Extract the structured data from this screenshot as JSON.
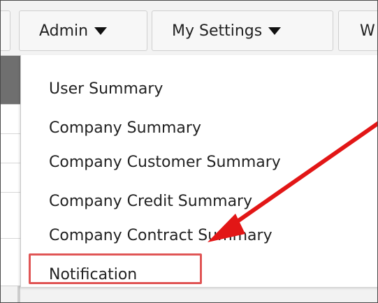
{
  "nav": {
    "admin_label": "Admin",
    "settings_label": "My Settings",
    "partial_label": "W"
  },
  "menu": {
    "items": [
      "User Summary",
      "Company Summary",
      "Company Customer Summary",
      "Company Credit Summary",
      "Company Contract Summary",
      "Notification"
    ]
  },
  "colors": {
    "highlight": "#e05555",
    "arrow": "#e21616"
  }
}
